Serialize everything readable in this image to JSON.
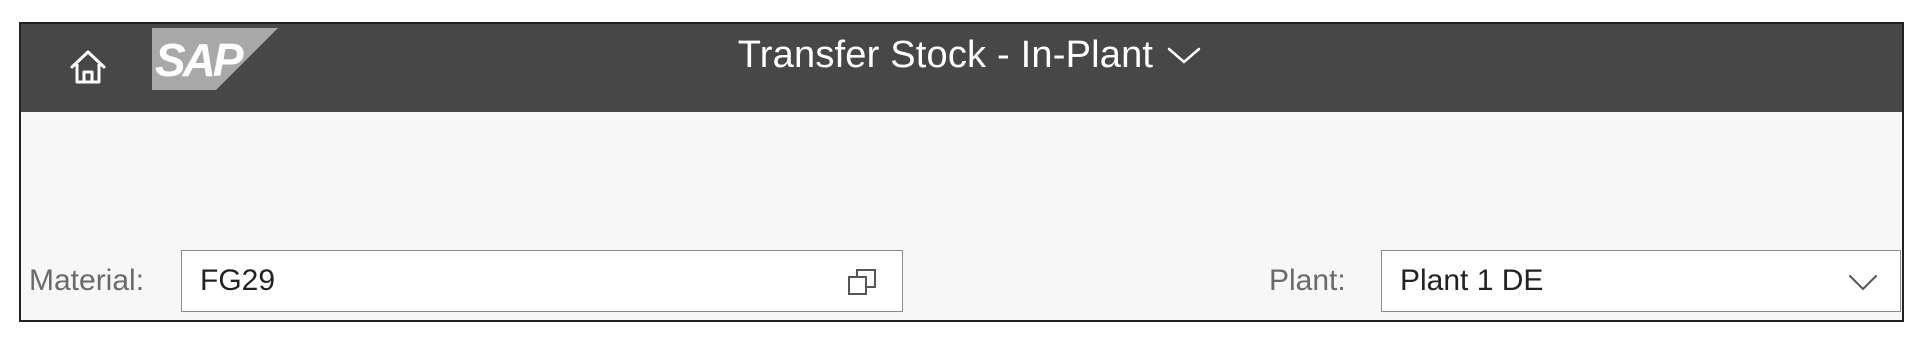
{
  "shellbar": {
    "home_icon": "home-icon",
    "logo_text": "SAP",
    "title": "Transfer Stock - In-Plant",
    "title_menu_icon": "chevron-down-icon",
    "background": "#474747"
  },
  "form": {
    "material": {
      "label": "Material:",
      "value": "FG29",
      "icon": "value-help-icon"
    },
    "plant": {
      "label": "Plant:",
      "value": "Plant 1 DE",
      "icon": "chevron-down-icon"
    }
  }
}
